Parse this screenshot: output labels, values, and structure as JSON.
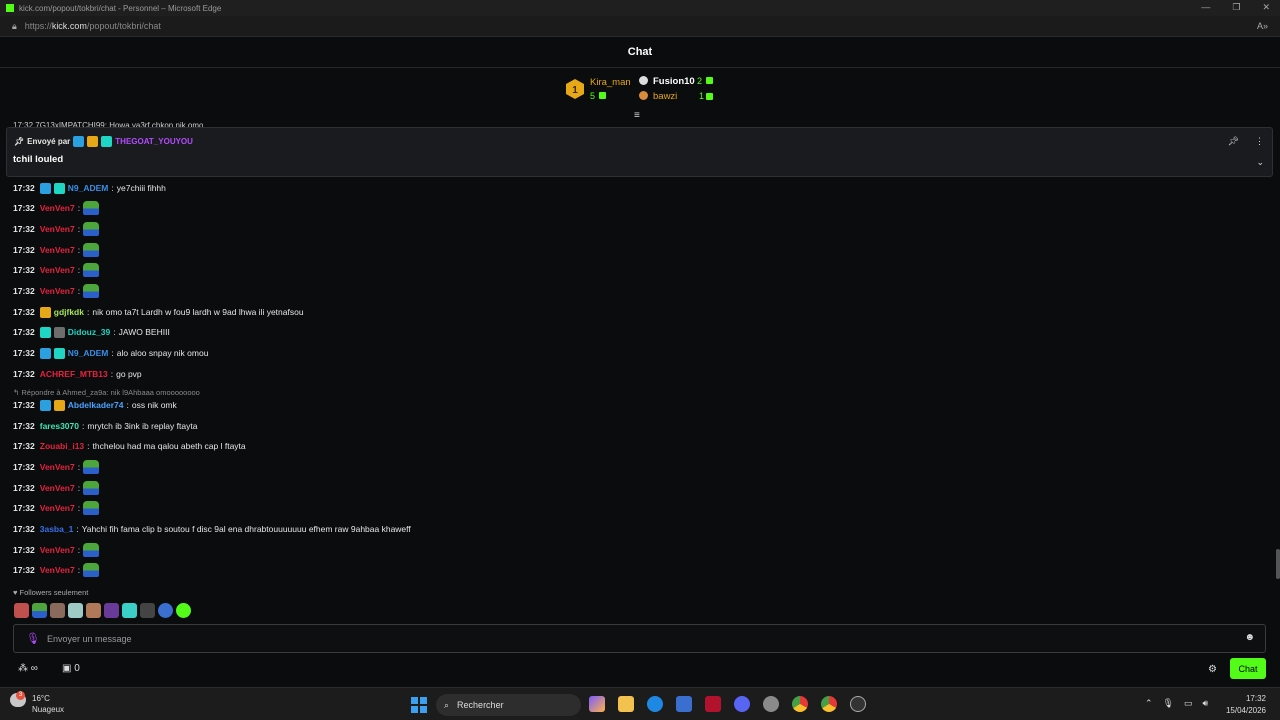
{
  "browser": {
    "title": "kick.com/popout/tokbri/chat - Personnel – Microsoft Edge",
    "url_prefix": "https://",
    "url_domain": "kick.com",
    "url_path": "/popout/tokbri/chat"
  },
  "chat_header": {
    "title": "Chat"
  },
  "leaderboard": {
    "first": {
      "rank": "1",
      "name": "Kira_man",
      "count": "5"
    },
    "second": {
      "name": "Fusion10",
      "count": "2"
    },
    "third": {
      "name": "bawzi",
      "count": "1"
    }
  },
  "pinned": {
    "sent_by_label": "Envoyé par",
    "user": "THEGOAT_YOUYOU",
    "message": "tchil louled",
    "partial_line": "17:32  7G13xIMPATCHI99: Howa ya3rf chkon nik omo"
  },
  "messages": [
    {
      "time": "17:32",
      "user": "N9_ADEM",
      "color": "#3a8ee6",
      "badges": [
        "blue",
        "teal"
      ],
      "text": "ye7chiii fihhh"
    },
    {
      "time": "17:32",
      "user": "VenVen7",
      "color": "#e5233d",
      "emote": true
    },
    {
      "time": "17:32",
      "user": "VenVen7",
      "color": "#e5233d",
      "emote": true
    },
    {
      "time": "17:32",
      "user": "VenVen7",
      "color": "#e5233d",
      "emote": true
    },
    {
      "time": "17:32",
      "user": "VenVen7",
      "color": "#e5233d",
      "emote": true
    },
    {
      "time": "17:32",
      "user": "VenVen7",
      "color": "#e5233d",
      "emote": true
    },
    {
      "time": "17:32",
      "user": "gdjfkdk",
      "color": "#a6e25a",
      "badges": [
        "gold"
      ],
      "text": "nik omo ta7t Lardh w fou9 lardh w 9ad lhwa ili yetnafsou"
    },
    {
      "time": "17:32",
      "user": "Didouz_39",
      "color": "#1fd6c4",
      "badges": [
        "teal",
        "grey"
      ],
      "text": "JAWO BEHIII"
    },
    {
      "time": "17:32",
      "user": "N9_ADEM",
      "color": "#3a8ee6",
      "badges": [
        "blue",
        "teal"
      ],
      "text": "alo aloo snpay nik omou"
    },
    {
      "time": "17:32",
      "user": "ACHREF_MTB13",
      "color": "#e5233d",
      "text": "go pvp"
    },
    {
      "time": "17:32",
      "user": "Abdelkader74",
      "color": "#4aa3ff",
      "badges": [
        "blue",
        "gold"
      ],
      "text": "oss nik omk"
    },
    {
      "time": "17:32",
      "user": "fares3070",
      "color": "#3ee6b4",
      "text": "mrytch ib 3ink ib replay ftayta"
    },
    {
      "time": "17:32",
      "user": "Zouabi_i13",
      "color": "#e5233d",
      "text": "thchelou had ma qalou abeth cap l ftayta"
    },
    {
      "time": "17:32",
      "user": "VenVen7",
      "color": "#e5233d",
      "emote": true
    },
    {
      "time": "17:32",
      "user": "VenVen7",
      "color": "#e5233d",
      "emote": true
    },
    {
      "time": "17:32",
      "user": "VenVen7",
      "color": "#e5233d",
      "emote": true
    },
    {
      "time": "17:32",
      "user": "3asba_1",
      "color": "#3a6fe6",
      "text": "Yahchi fih fama clip b soutou f disc 9al ena dhrabtouuuuuuu efhem raw 9ahbaa khaweff"
    },
    {
      "time": "17:32",
      "user": "VenVen7",
      "color": "#e5233d",
      "emote": true
    },
    {
      "time": "17:32",
      "user": "VenVen7",
      "color": "#e5233d",
      "emote": true
    }
  ],
  "reply_context": "Répondre à Ahmed_za9a: nik l9Ahbaaa omoooooooo",
  "followers_only": "Followers seulement",
  "input": {
    "placeholder": "Envoyer un message"
  },
  "bottom": {
    "count": "0",
    "chat_button": "Chat"
  },
  "taskbar": {
    "temp": "16°C",
    "weather": "Nuageux",
    "weather_badge": "3",
    "search": "Rechercher",
    "time": "17:32",
    "date": "15/04/2026"
  },
  "colors": {
    "kick_green": "#53fc18",
    "accent_purple": "#b34cff",
    "pinned_user": "#b34cff"
  }
}
